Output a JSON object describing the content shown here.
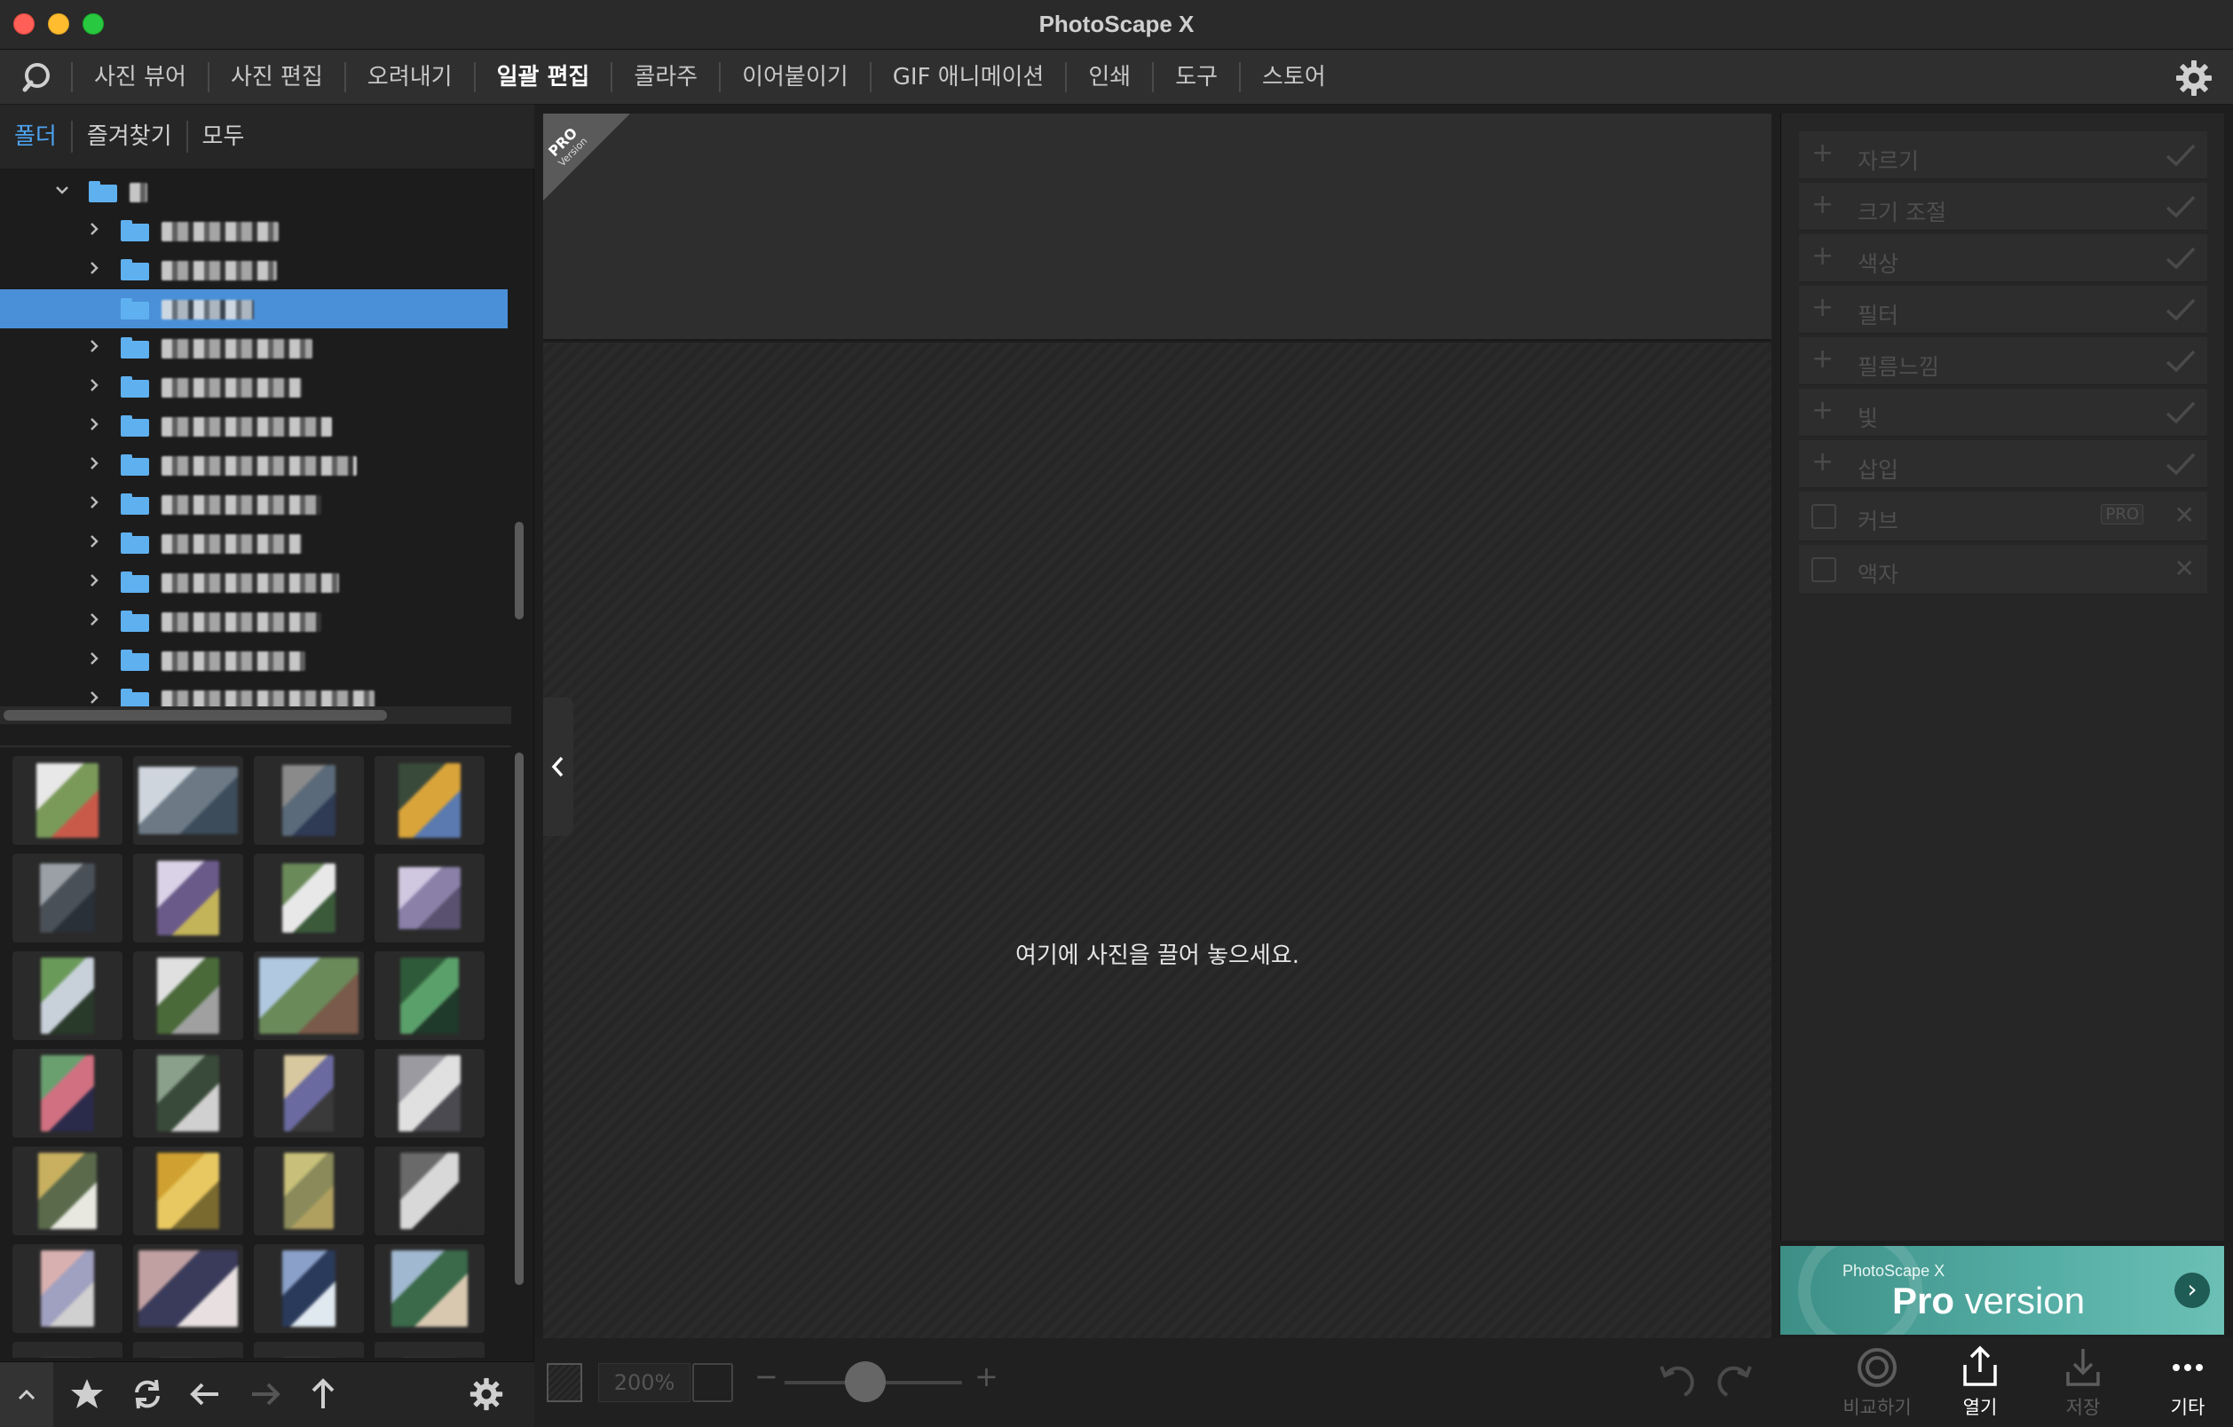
{
  "window": {
    "title": "PhotoScape X"
  },
  "nav": {
    "tabs": [
      {
        "label": "사진 뷰어"
      },
      {
        "label": "사진 편집"
      },
      {
        "label": "오려내기"
      },
      {
        "label": "일괄 편집",
        "active": true
      },
      {
        "label": "콜라주"
      },
      {
        "label": "이어붙이기"
      },
      {
        "label": "GIF 애니메이션"
      },
      {
        "label": "인쇄"
      },
      {
        "label": "도구"
      },
      {
        "label": "스토어"
      }
    ],
    "icons": {
      "logo": "photoscape-logo-icon",
      "settings": "gear-icon"
    }
  },
  "left_panel": {
    "tabs": [
      {
        "label": "폴더",
        "active": true
      },
      {
        "label": "즐겨찾기"
      },
      {
        "label": "모두"
      }
    ],
    "tree_note": "folder names are pixelated/obscured in the screenshot",
    "tree_rows": [
      {
        "expanded": true,
        "level": 0
      },
      {
        "expanded": false,
        "level": 1
      },
      {
        "expanded": false,
        "level": 1
      },
      {
        "expanded": false,
        "level": 1,
        "selected": true,
        "no_children": true
      },
      {
        "expanded": false,
        "level": 1
      },
      {
        "expanded": false,
        "level": 1
      },
      {
        "expanded": false,
        "level": 1
      },
      {
        "expanded": false,
        "level": 1
      },
      {
        "expanded": false,
        "level": 1
      },
      {
        "expanded": false,
        "level": 1
      },
      {
        "expanded": false,
        "level": 1
      },
      {
        "expanded": false,
        "level": 1
      },
      {
        "expanded": false,
        "level": 1
      },
      {
        "expanded": false,
        "level": 1
      }
    ],
    "thumbnail_count_visible": 28,
    "toolbar_icons": [
      "chevron-up-icon",
      "star-icon",
      "refresh-icon",
      "arrow-left-icon",
      "arrow-right-icon",
      "arrow-up-icon",
      "gear-icon"
    ]
  },
  "canvas": {
    "pro_badge": {
      "line1": "PRO",
      "line2": "Version"
    },
    "drop_hint": "여기에 사진을 끌어 놓으세요.",
    "zoom_value": "200%"
  },
  "adjustments": {
    "items": [
      {
        "label": "자르기",
        "kind": "plus"
      },
      {
        "label": "크기 조절",
        "kind": "plus"
      },
      {
        "label": "색상",
        "kind": "plus"
      },
      {
        "label": "필터",
        "kind": "plus"
      },
      {
        "label": "필름느낌",
        "kind": "plus"
      },
      {
        "label": "빛",
        "kind": "plus"
      },
      {
        "label": "삽입",
        "kind": "plus"
      },
      {
        "label": "커브",
        "kind": "checkbox",
        "badge": "PRO"
      },
      {
        "label": "액자",
        "kind": "checkbox"
      }
    ]
  },
  "promo": {
    "small": "PhotoScape X",
    "big_bold": "Pro",
    "big_rest": " version"
  },
  "actions": [
    {
      "label": "비교하기",
      "icon": "compare-icon",
      "enabled": false
    },
    {
      "label": "열기",
      "icon": "share-upload-icon",
      "enabled": true
    },
    {
      "label": "저장",
      "icon": "download-icon",
      "enabled": false
    },
    {
      "label": "기타",
      "icon": "more-icon",
      "enabled": true
    }
  ],
  "colors": {
    "accent": "#4a90d9",
    "active_tab": "#4da3f0",
    "folder": "#5fb0ef",
    "promo": "#55aea5"
  }
}
